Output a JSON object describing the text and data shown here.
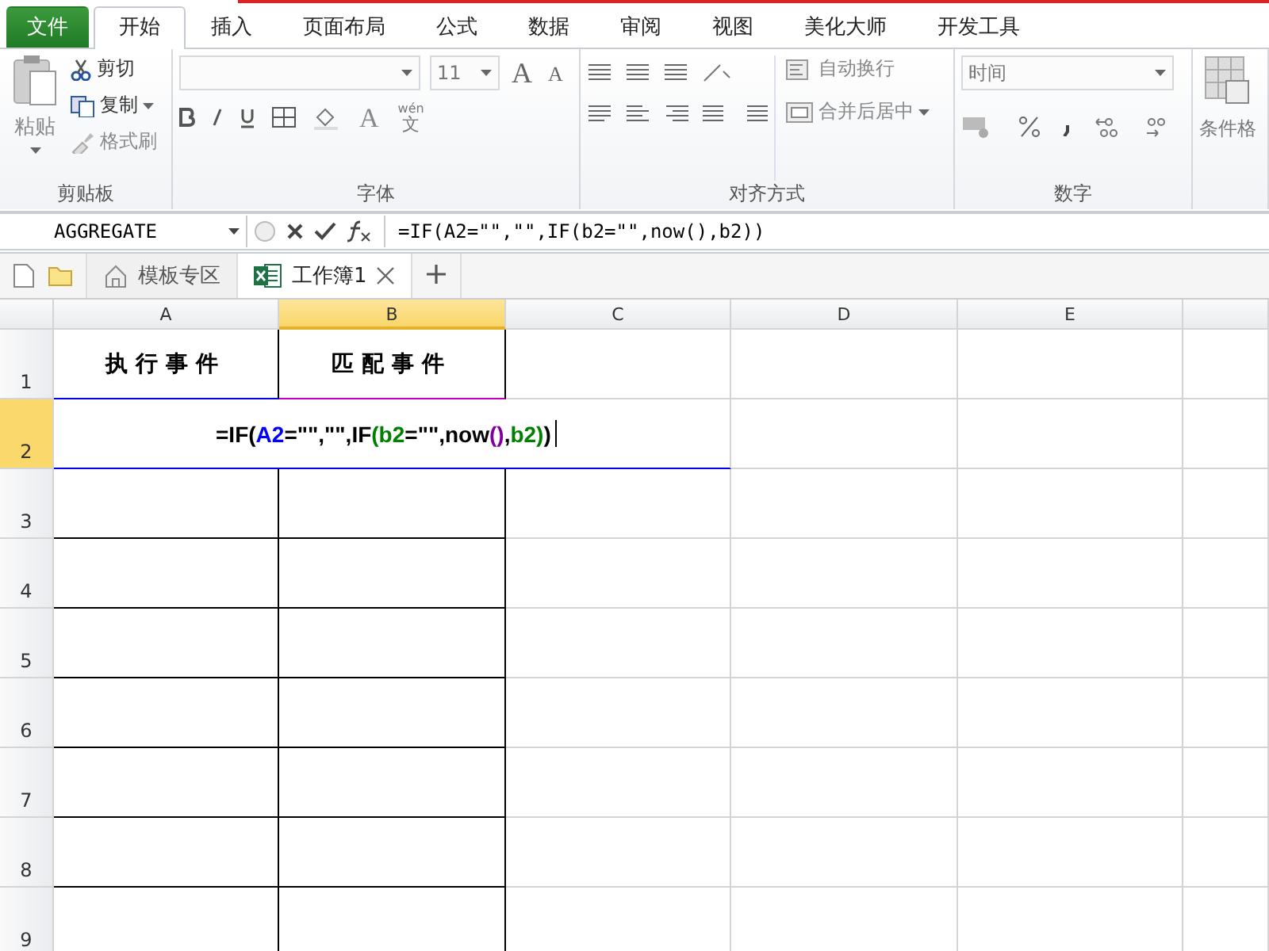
{
  "ribbon_tabs": [
    {
      "label": "文件",
      "kind": "file",
      "selected": false
    },
    {
      "label": "开始",
      "kind": "tab",
      "selected": true
    },
    {
      "label": "插入",
      "kind": "tab",
      "selected": false
    },
    {
      "label": "页面布局",
      "kind": "tab",
      "selected": false
    },
    {
      "label": "公式",
      "kind": "tab",
      "selected": false
    },
    {
      "label": "数据",
      "kind": "tab",
      "selected": false
    },
    {
      "label": "审阅",
      "kind": "tab",
      "selected": false
    },
    {
      "label": "视图",
      "kind": "tab",
      "selected": false
    },
    {
      "label": "美化大师",
      "kind": "tab",
      "selected": false
    },
    {
      "label": "开发工具",
      "kind": "tab",
      "selected": false
    }
  ],
  "ribbon": {
    "clipboard": {
      "paste": "粘贴",
      "cut": "剪切",
      "copy": "复制",
      "format_painter": "格式刷",
      "title": "剪贴板"
    },
    "font": {
      "font_size": "11",
      "grow_font": "A",
      "shrink_font": "A",
      "font_color": "A",
      "phonetic_reading": "wén",
      "phonetic_char": "文",
      "title": "字体"
    },
    "alignment": {
      "wrap_text": "自动换行",
      "merge_center": "合并后居中",
      "title": "对齐方式"
    },
    "number": {
      "format": "时间",
      "title": "数字"
    },
    "styles": {
      "conditional_format": "条件格"
    }
  },
  "formula_bar": {
    "name_box": "AGGREGATE",
    "formula": "=IF(A2=\"\",\"\",IF(b2=\"\",now(),b2))"
  },
  "doc_tabs": [
    {
      "label": "模板专区",
      "kind": "template",
      "selected": false
    },
    {
      "label": "工作簿1",
      "kind": "workbook",
      "selected": true
    }
  ],
  "sheet": {
    "columns": [
      {
        "label": "A",
        "selected": false
      },
      {
        "label": "B",
        "selected": true
      },
      {
        "label": "C",
        "selected": false
      },
      {
        "label": "D",
        "selected": false
      },
      {
        "label": "E",
        "selected": false
      }
    ],
    "rows": [
      {
        "label": "1",
        "selected": false,
        "cells": [
          "执行事件",
          "匹配事件"
        ]
      },
      {
        "label": "2",
        "selected": true,
        "editing": [
          {
            "text": "=IF(",
            "color": "#000000"
          },
          {
            "text": "A2",
            "color": "#0000ff"
          },
          {
            "text": "=\"\",\"\",IF",
            "color": "#000000"
          },
          {
            "text": "(b2",
            "color": "#008000"
          },
          {
            "text": "=\"\",now",
            "color": "#000000"
          },
          {
            "text": "()",
            "color": "#8000a0"
          },
          {
            "text": ",",
            "color": "#000000"
          },
          {
            "text": "b2)",
            "color": "#008000"
          },
          {
            "text": ")",
            "color": "#000000"
          }
        ]
      },
      {
        "label": "3",
        "selected": false,
        "cells": []
      },
      {
        "label": "4",
        "selected": false,
        "cells": []
      },
      {
        "label": "5",
        "selected": false,
        "cells": []
      },
      {
        "label": "6",
        "selected": false,
        "cells": []
      },
      {
        "label": "7",
        "selected": false,
        "cells": []
      },
      {
        "label": "8",
        "selected": false,
        "cells": []
      },
      {
        "label": "9",
        "selected": false,
        "cells": []
      }
    ]
  }
}
